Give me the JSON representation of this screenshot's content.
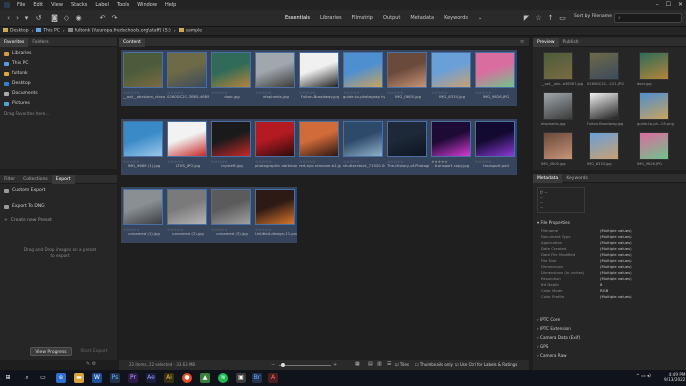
{
  "menu": [
    "File",
    "Edit",
    "View",
    "Stacks",
    "Label",
    "Tools",
    "Window",
    "Help"
  ],
  "workspaces": [
    "Essentials",
    "Libraries",
    "Filmstrip",
    "Output",
    "Metadata",
    "Keywords"
  ],
  "sort_label": "Sort by Filename",
  "search_placeholder": "",
  "path": [
    "Desktop",
    "This PC",
    "fultonk (\\\\europa.fredschools.org\\staff) (S:)",
    "sample"
  ],
  "left_tabs": [
    "Favorites",
    "Folders"
  ],
  "favorites": [
    "Libraries",
    "This PC",
    "fultonk",
    "Desktop",
    "Documents",
    "Pictures"
  ],
  "favorites_hint": "Drag Favorites here...",
  "filter_tabs": [
    "Filter",
    "Collections",
    "Export"
  ],
  "export_items": [
    "Custom Export",
    "Export To DNG",
    "Create new Preset"
  ],
  "export_hint": "Drag and Drop images on a preset to export",
  "view_progress": "View Progress",
  "start_export": "Start Export",
  "content_tab": "Content",
  "rating_stars": "☆☆☆☆☆",
  "rating_stars_filled": "★★★★★",
  "thumbs_row1": [
    "__oot__abcstom_ctoco._o36367.jpg",
    "0260DC2C-3B85-4689-84C6..C0E21.JPG",
    "door.jpg",
    "elephants.jpg",
    "Fulton-Broadway.jpg",
    "guide-to-photograp hy-com...05.png",
    "IMG_0605.jpg",
    "IMG_8334.jpg",
    "IMG_9626.JPG"
  ],
  "thumbs_row2": [
    "IMG_9669 (1).jpg",
    "LTHS_JPG.jpg",
    "mysteft.jpg",
    "photographic darkroom signs.jpg",
    "red-eye-remover-b1.jpg",
    "shutterstock_71520 0006.jpg",
    "The-History-of-Photograph...etures.jpeg",
    "transport copy.jpg",
    "transport.psd"
  ],
  "thumbs_row3": [
    "unnamed (1).jpg",
    "unnamed (2).jpg",
    "unnamed (3).jpg",
    "Untitled-design-11.png"
  ],
  "row2_ratings": [
    "☆☆☆☆☆",
    "☆☆☆☆☆",
    "☆☆☆☆☆",
    "☆☆☆☆☆",
    "☆☆☆☆☆",
    "☆☆☆☆☆",
    "☆☆☆☆☆",
    "★★★★★",
    "☆☆☆☆☆"
  ],
  "status_text": "22 items, 22 selected - 33.63 MB",
  "bottom_options": [
    "Tiles",
    "Thumbnails only",
    "Use Ctrl for Labels & Ratings"
  ],
  "right_tabs": [
    "Preview",
    "Publish"
  ],
  "preview_names": [
    "__oot__abc..o36367.jpg",
    "0260DC2C...C21.JPG",
    "door.jpg",
    "elephants.jpg",
    "Fulton-Broadway.jpg",
    "guide-to-ph...05.png",
    "IMG_0605.jpg",
    "IMG_8334.jpg",
    "IMG_9626.JPG"
  ],
  "meta_tabs": [
    "Metadata",
    "Keywords"
  ],
  "meta_camera": [
    "f/ --",
    "--",
    "--",
    "--"
  ],
  "file_properties_label": "File Properties",
  "file_properties": [
    {
      "k": "Filename",
      "v": "(Multiple values)"
    },
    {
      "k": "Document Type",
      "v": "(Multiple values)"
    },
    {
      "k": "Application",
      "v": "(Multiple values)"
    },
    {
      "k": "Date Created",
      "v": "(Multiple values)"
    },
    {
      "k": "Date File Modified",
      "v": "(Multiple values)"
    },
    {
      "k": "File Size",
      "v": "(Multiple values)"
    },
    {
      "k": "Dimensions",
      "v": "(Multiple values)"
    },
    {
      "k": "Dimensions (in inches)",
      "v": "(Multiple values)"
    },
    {
      "k": "Resolution",
      "v": "(Multiple values)"
    },
    {
      "k": "Bit Depth",
      "v": "8"
    },
    {
      "k": "Color Mode",
      "v": "RGB"
    },
    {
      "k": "Color Profile",
      "v": "(Multiple values)"
    }
  ],
  "meta_sections": [
    "IPTC Core",
    "IPTC Extension",
    "Camera Data (Exif)",
    "GPS",
    "Camera Raw"
  ],
  "clock": {
    "time": "4:49 PM",
    "date": "9/13/2022"
  },
  "colors": {
    "selection": "#4a6fa5",
    "folder": "#d6a84a",
    "taskbar": "#101319"
  }
}
